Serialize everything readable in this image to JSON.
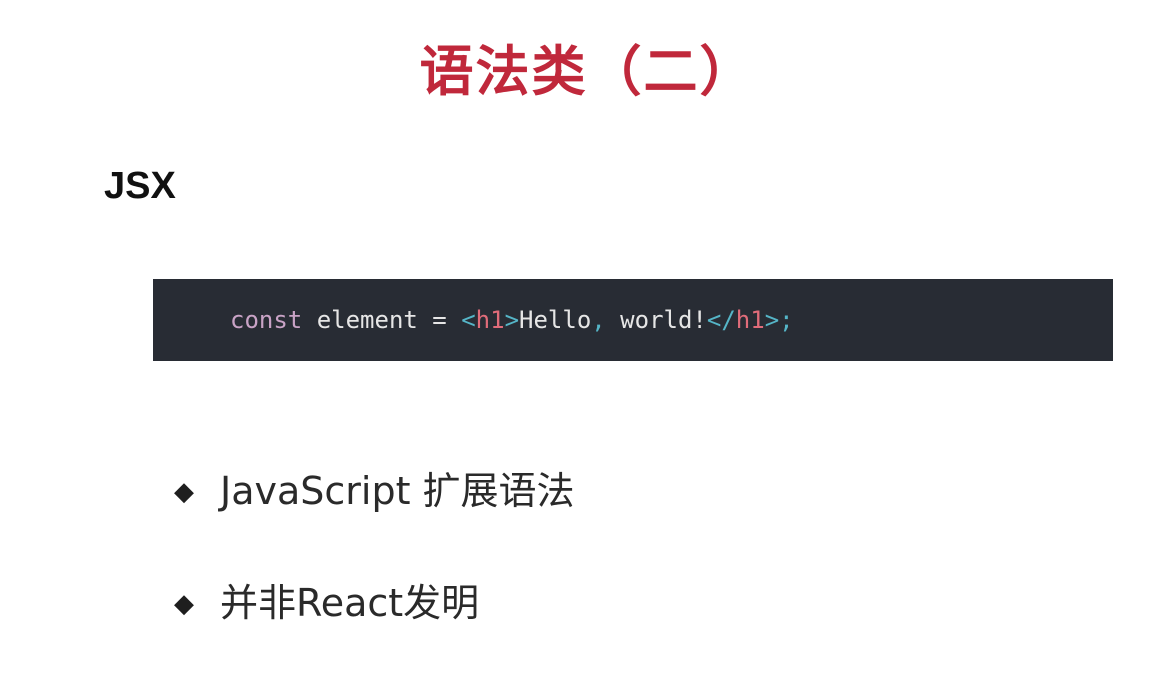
{
  "slide": {
    "title": "语法类（二）",
    "subtitle": "JSX",
    "code": {
      "tokens": [
        {
          "text": "const",
          "cls": "tok-keyword"
        },
        {
          "text": " element = ",
          "cls": "tok-plain"
        },
        {
          "text": "<",
          "cls": "tok-bracket"
        },
        {
          "text": "h1",
          "cls": "tok-tag"
        },
        {
          "text": ">",
          "cls": "tok-bracket"
        },
        {
          "text": "Hello",
          "cls": "tok-plain"
        },
        {
          "text": ",",
          "cls": "tok-punct"
        },
        {
          "text": " world!",
          "cls": "tok-plain"
        },
        {
          "text": "</",
          "cls": "tok-bracket"
        },
        {
          "text": "h1",
          "cls": "tok-tag"
        },
        {
          "text": ">",
          "cls": "tok-bracket"
        },
        {
          "text": ";",
          "cls": "tok-semi"
        }
      ]
    },
    "bullets": [
      {
        "icon": "diamond-bullet-icon",
        "glyph": "◆",
        "text": "JavaScript 扩展语法"
      },
      {
        "icon": "diamond-bullet-icon",
        "glyph": "◆",
        "text": "并非React发明"
      }
    ]
  },
  "colors": {
    "title": "#c0283b",
    "code_background": "#282c34",
    "code_keyword": "#c9a3c6",
    "code_tag": "#e06c7a",
    "code_bracket": "#55b5c7",
    "code_text": "#e6e6e6"
  }
}
